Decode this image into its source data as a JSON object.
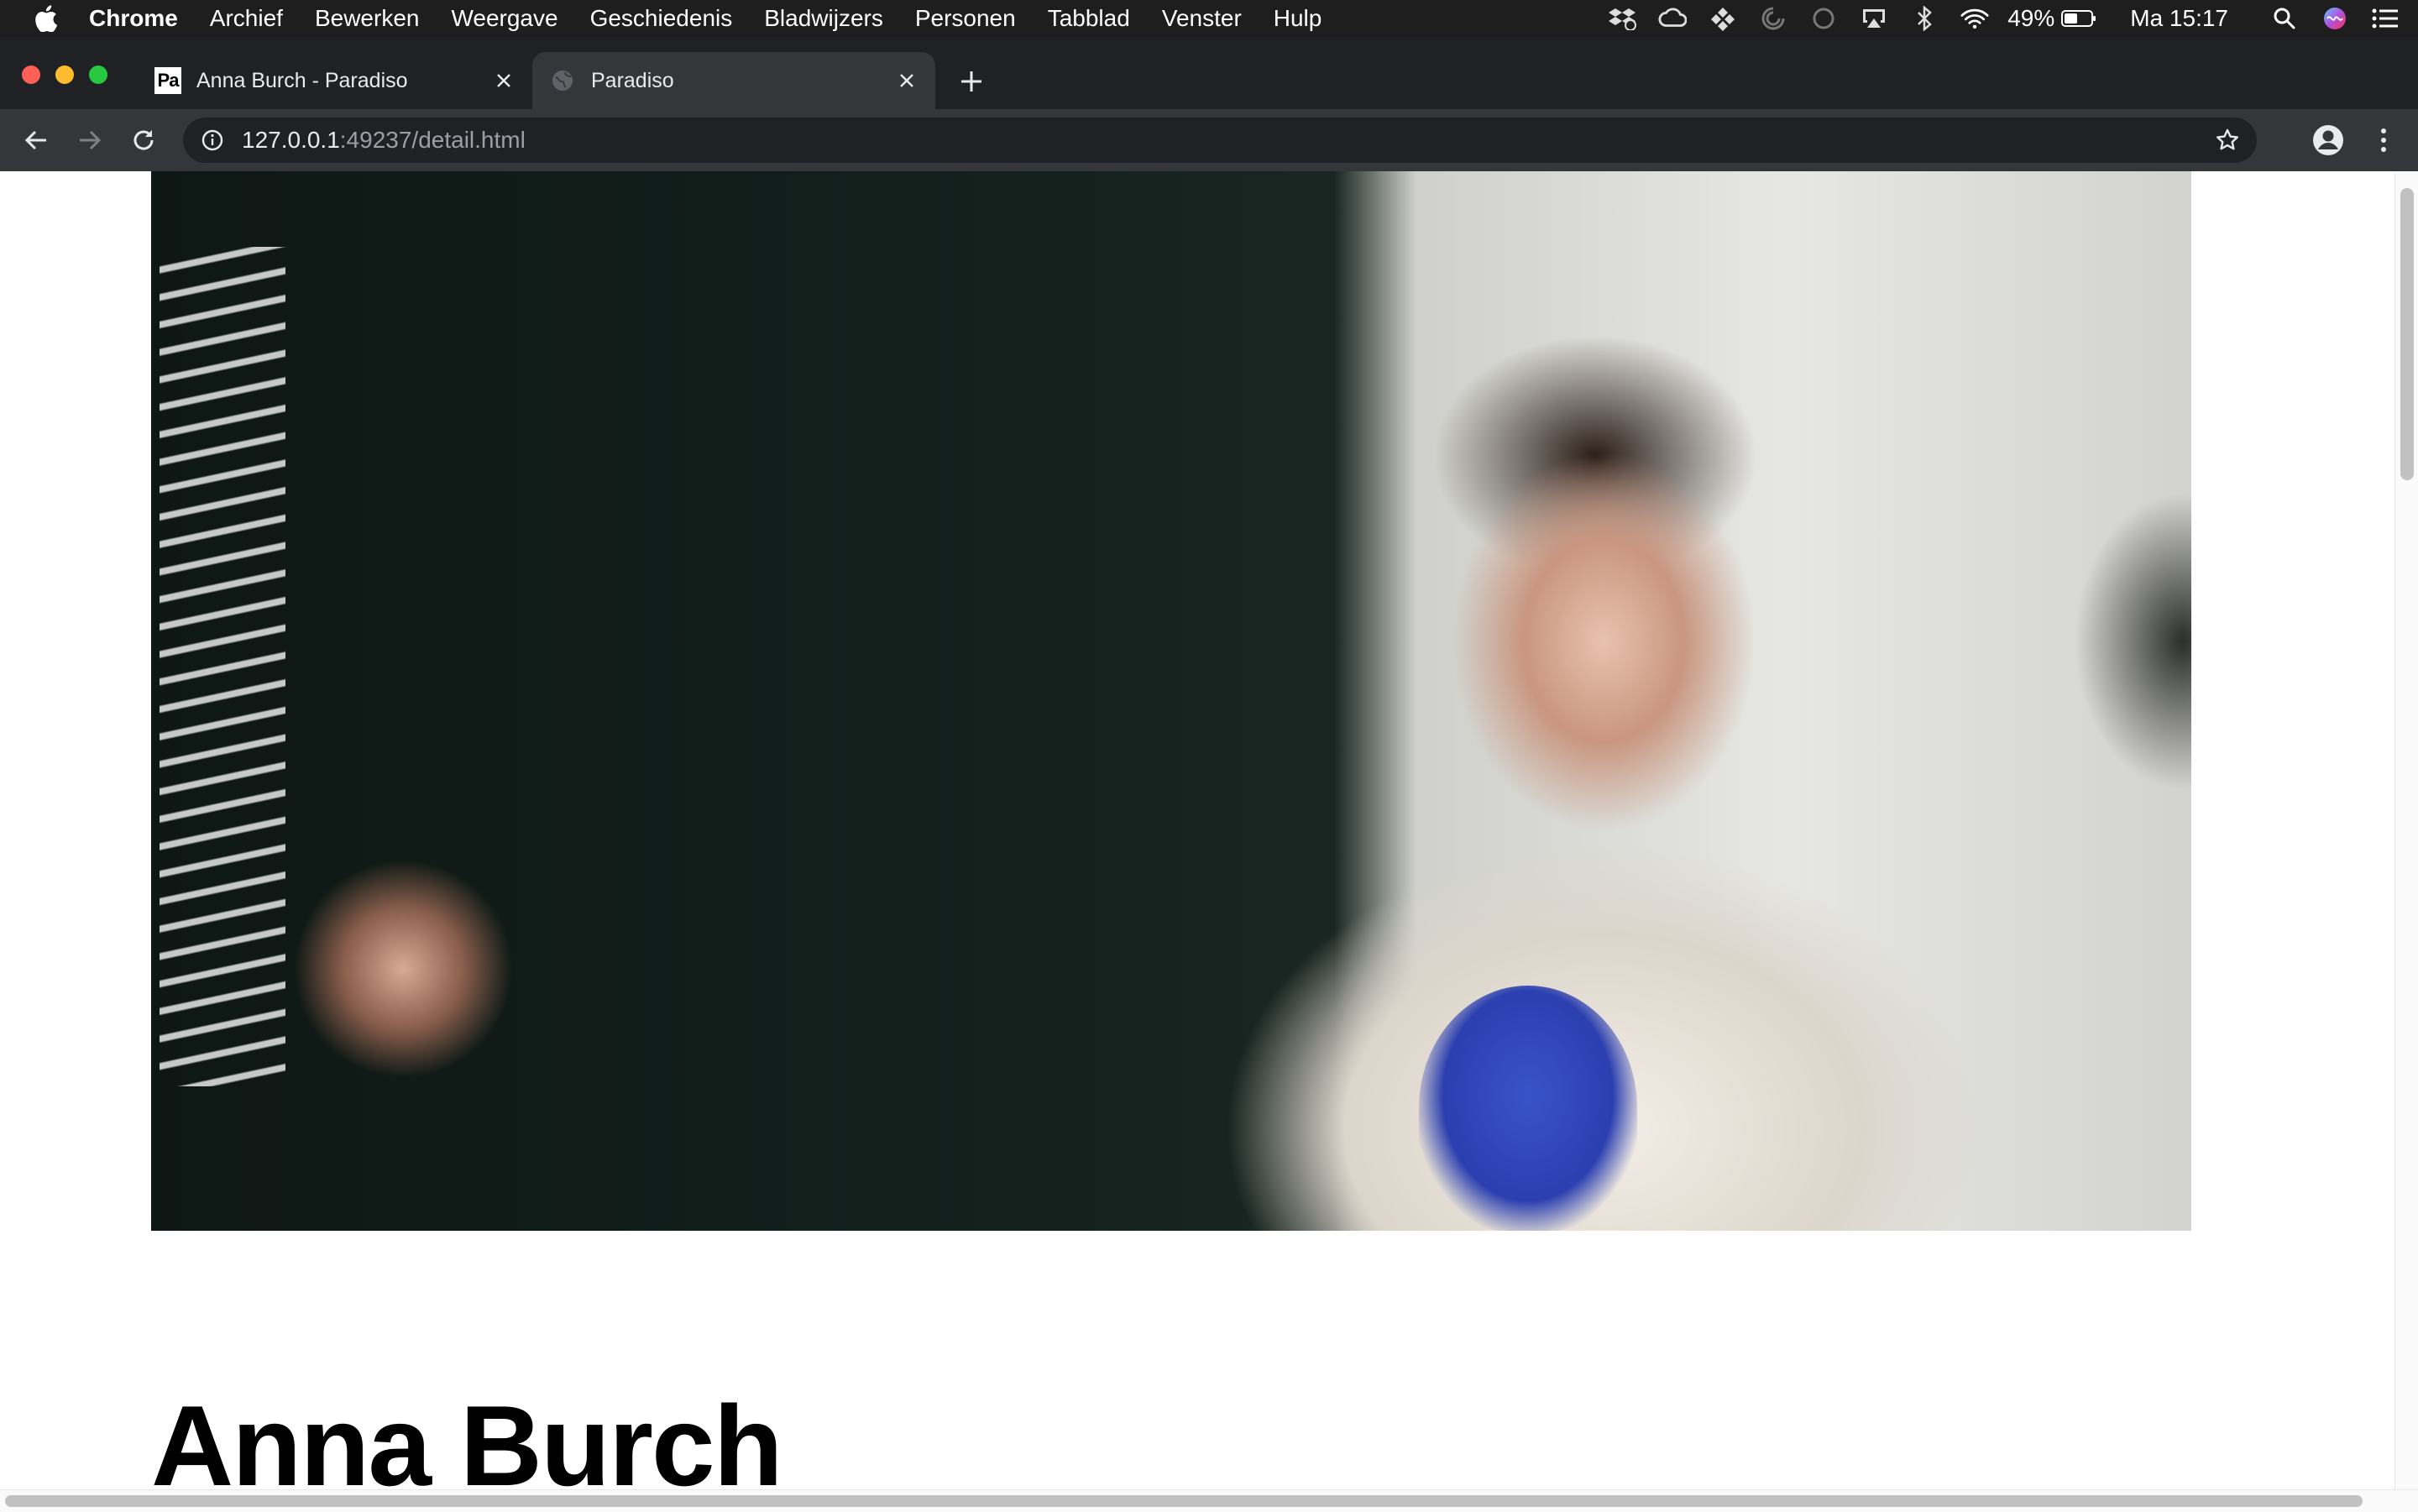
{
  "menubar": {
    "app_name": "Chrome",
    "items": [
      "Archief",
      "Bewerken",
      "Weergave",
      "Geschiedenis",
      "Bladwijzers",
      "Personen",
      "Tabblad",
      "Venster",
      "Hulp"
    ],
    "battery": "49%",
    "clock": "Ma 15:17"
  },
  "tabs": [
    {
      "title": "Anna Burch - Paradiso",
      "favicon_text": "Pa",
      "active": false
    },
    {
      "title": "Paradiso",
      "active": true
    }
  ],
  "address_bar": {
    "host": "127.0.0.1",
    "path": ":49237/detail.html"
  },
  "page": {
    "hero_image_alt": "Anna Burch",
    "artist_name": "Anna Burch"
  }
}
